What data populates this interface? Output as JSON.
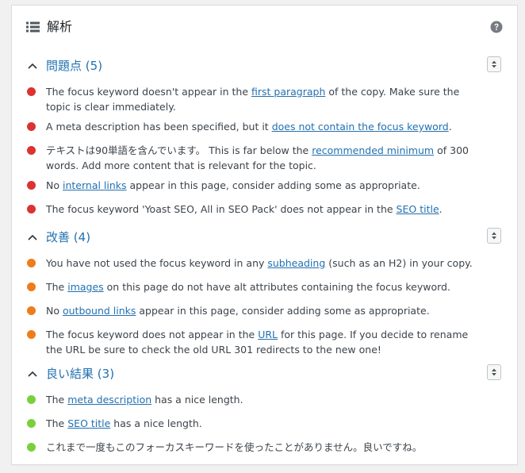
{
  "header": {
    "title": "解析"
  },
  "sections": [
    {
      "title": "問題点",
      "count": "(5)",
      "color": "#dc3232",
      "items": [
        {
          "pre": "The focus keyword doesn't appear in the ",
          "link": "first paragraph",
          "post": " of the copy. Make sure the topic is clear immediately."
        },
        {
          "pre": "A meta description has been specified, but it ",
          "link": "does not contain the focus keyword",
          "post": "."
        },
        {
          "pre": "テキストは90単語を含んでいます。 This is far below the ",
          "link": "recommended minimum",
          "post": " of 300 words. Add more content that is relevant for the topic."
        },
        {
          "pre": "No ",
          "link": "internal links",
          "post": " appear in this page, consider adding some as appropriate."
        },
        {
          "pre": "The focus keyword 'Yoast SEO, All in SEO Pack' does not appear in the ",
          "link": "SEO title",
          "post": "."
        }
      ]
    },
    {
      "title": "改善",
      "count": "(4)",
      "color": "#ee7c1b",
      "items": [
        {
          "pre": "You have not used the focus keyword in any ",
          "link": "subheading",
          "post": " (such as an H2) in your copy."
        },
        {
          "pre": "The ",
          "link": "images",
          "post": " on this page do not have alt attributes containing the focus keyword."
        },
        {
          "pre": "No ",
          "link": "outbound links",
          "post": " appear in this page, consider adding some as appropriate."
        },
        {
          "pre": "The focus keyword does not appear in the ",
          "link": "URL",
          "post": " for this page. If you decide to rename the URL be sure to check the old URL 301 redirects to the new one!"
        }
      ]
    },
    {
      "title": "良い結果",
      "count": "(3)",
      "color": "#7ad03a",
      "items": [
        {
          "pre": "The ",
          "link": "meta description",
          "post": " has a nice length."
        },
        {
          "pre": "The ",
          "link": "SEO title",
          "post": " has a nice length."
        },
        {
          "pre": "これまで一度もこのフォーカスキーワードを使ったことがありません。良いですね。",
          "link": "",
          "post": ""
        }
      ]
    }
  ]
}
